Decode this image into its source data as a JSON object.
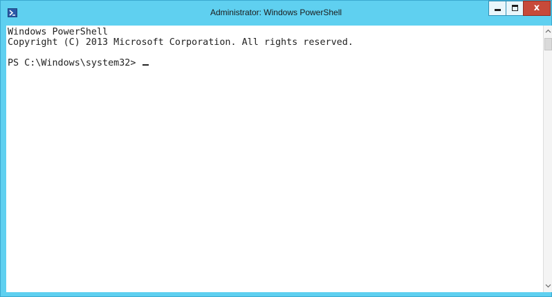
{
  "window": {
    "title": "Administrator: Windows PowerShell",
    "controls": {
      "minimize": "minimize",
      "maximize": "maximize",
      "close": "x"
    }
  },
  "console": {
    "line1": "Windows PowerShell",
    "line2": "Copyright (C) 2013 Microsoft Corporation. All rights reserved.",
    "line3": "",
    "prompt": "PS C:\\Windows\\system32> "
  },
  "colors": {
    "frame": "#5fd0f0",
    "close_button": "#c74a3a",
    "console_background": "#ffffff",
    "console_text": "#222222"
  },
  "icons": {
    "app": "powershell-icon",
    "scroll_up": "chevron-up-icon",
    "scroll_down": "chevron-down-icon"
  }
}
